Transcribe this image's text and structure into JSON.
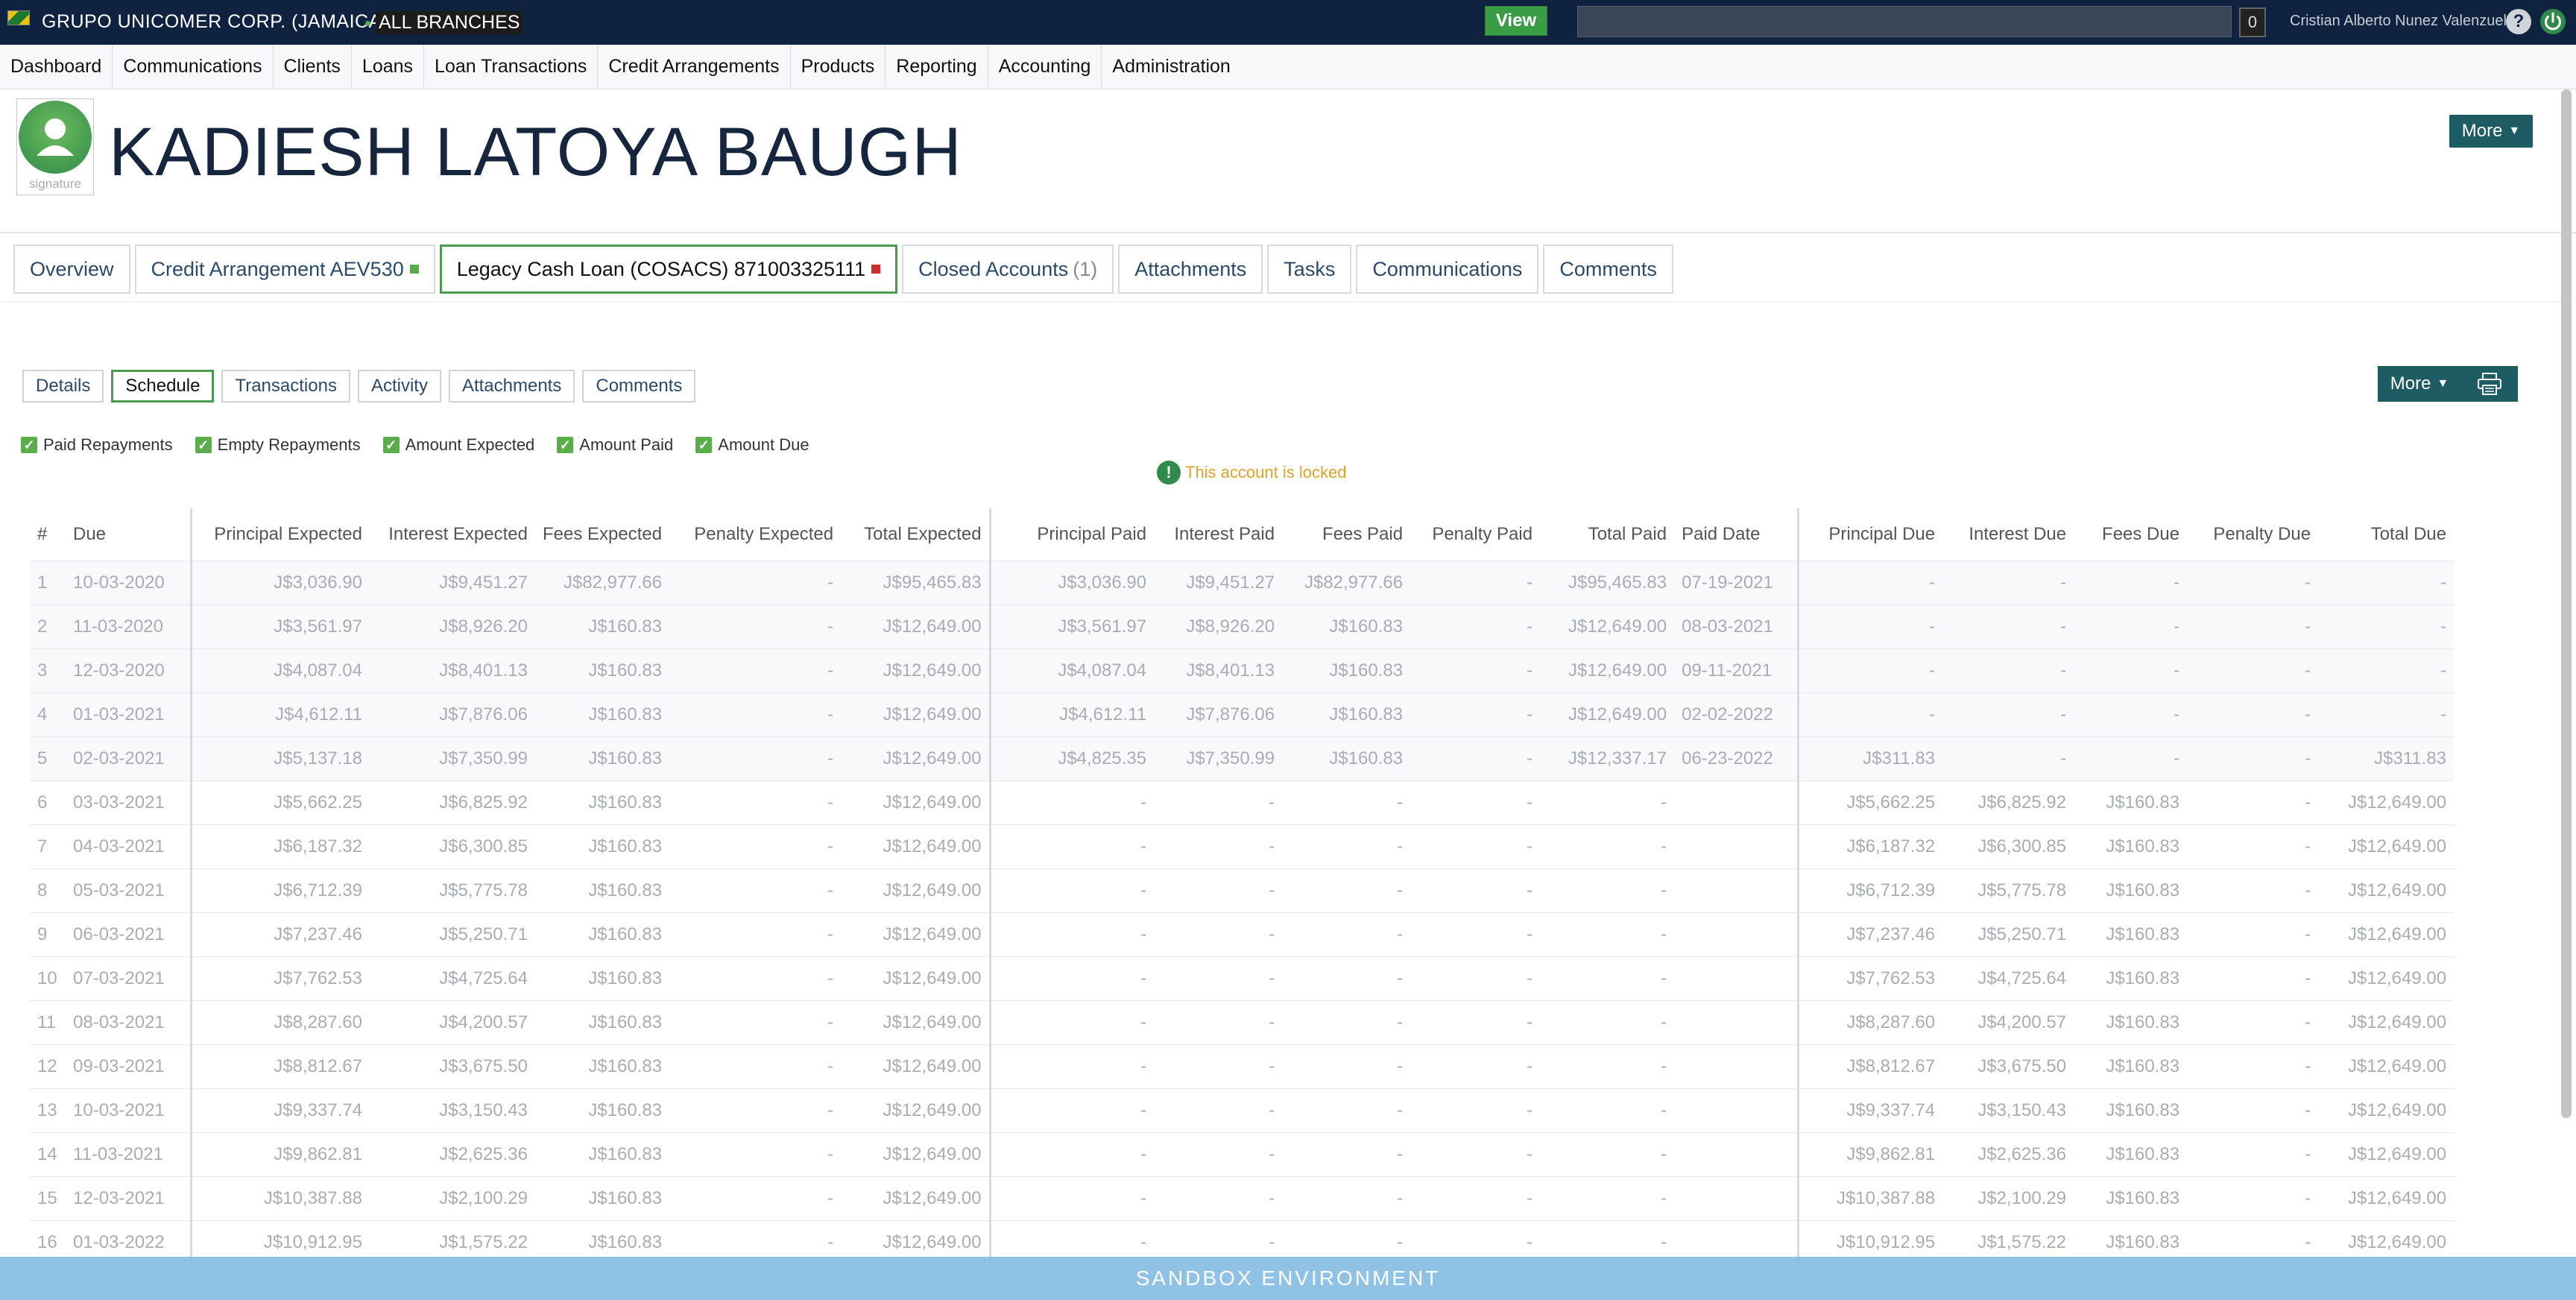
{
  "topbar": {
    "org_name": "GRUPO UNICOMER CORP. (JAMAICA)",
    "branch": "ALL BRANCHES",
    "view_label": "View",
    "search_value": "",
    "notif_count": "0",
    "user_name": "Cristian Alberto Nunez Valenzuela",
    "help_label": "?"
  },
  "nav": {
    "items": [
      "Dashboard",
      "Communications",
      "Clients",
      "Loans",
      "Loan Transactions",
      "Credit Arrangements",
      "Products",
      "Reporting",
      "Accounting",
      "Administration"
    ]
  },
  "client": {
    "name": "KADIESH LATOYA BAUGH",
    "avatar_label": "signature",
    "more_label": "More"
  },
  "account_tabs": {
    "overview": "Overview",
    "credit_arrangement": "Credit Arrangement AEV530",
    "legacy_loan": "Legacy Cash Loan (COSACS) 871003325111",
    "closed_accounts": "Closed Accounts",
    "closed_count": "(1)",
    "attachments": "Attachments",
    "tasks": "Tasks",
    "communications": "Communications",
    "comments": "Comments"
  },
  "sub_tabs": {
    "details": "Details",
    "schedule": "Schedule",
    "transactions": "Transactions",
    "activity": "Activity",
    "attachments": "Attachments",
    "comments": "Comments",
    "more_label": "More"
  },
  "filters": {
    "paid_repayments": "Paid Repayments",
    "empty_repayments": "Empty Repayments",
    "amount_expected": "Amount Expected",
    "amount_paid": "Amount Paid",
    "amount_due": "Amount Due"
  },
  "lock_message": "This account is locked",
  "columns": [
    "#",
    "Due",
    "Principal Expected",
    "Interest Expected",
    "Fees Expected",
    "Penalty Expected",
    "Total Expected",
    "Principal Paid",
    "Interest Paid",
    "Fees Paid",
    "Penalty Paid",
    "Total Paid",
    "Paid Date",
    "Principal Due",
    "Interest Due",
    "Fees Due",
    "Penalty Due",
    "Total Due"
  ],
  "rows": [
    [
      "1",
      "10-03-2020",
      "J$3,036.90",
      "J$9,451.27",
      "J$82,977.66",
      "-",
      "J$95,465.83",
      "J$3,036.90",
      "J$9,451.27",
      "J$82,977.66",
      "-",
      "J$95,465.83",
      "07-19-2021",
      "-",
      "-",
      "-",
      "-",
      "-"
    ],
    [
      "2",
      "11-03-2020",
      "J$3,561.97",
      "J$8,926.20",
      "J$160.83",
      "-",
      "J$12,649.00",
      "J$3,561.97",
      "J$8,926.20",
      "J$160.83",
      "-",
      "J$12,649.00",
      "08-03-2021",
      "-",
      "-",
      "-",
      "-",
      "-"
    ],
    [
      "3",
      "12-03-2020",
      "J$4,087.04",
      "J$8,401.13",
      "J$160.83",
      "-",
      "J$12,649.00",
      "J$4,087.04",
      "J$8,401.13",
      "J$160.83",
      "-",
      "J$12,649.00",
      "09-11-2021",
      "-",
      "-",
      "-",
      "-",
      "-"
    ],
    [
      "4",
      "01-03-2021",
      "J$4,612.11",
      "J$7,876.06",
      "J$160.83",
      "-",
      "J$12,649.00",
      "J$4,612.11",
      "J$7,876.06",
      "J$160.83",
      "-",
      "J$12,649.00",
      "02-02-2022",
      "-",
      "-",
      "-",
      "-",
      "-"
    ],
    [
      "5",
      "02-03-2021",
      "J$5,137.18",
      "J$7,350.99",
      "J$160.83",
      "-",
      "J$12,649.00",
      "J$4,825.35",
      "J$7,350.99",
      "J$160.83",
      "-",
      "J$12,337.17",
      "06-23-2022",
      "J$311.83",
      "-",
      "-",
      "-",
      "J$311.83"
    ],
    [
      "6",
      "03-03-2021",
      "J$5,662.25",
      "J$6,825.92",
      "J$160.83",
      "-",
      "J$12,649.00",
      "-",
      "-",
      "-",
      "-",
      "-",
      "",
      "J$5,662.25",
      "J$6,825.92",
      "J$160.83",
      "-",
      "J$12,649.00"
    ],
    [
      "7",
      "04-03-2021",
      "J$6,187.32",
      "J$6,300.85",
      "J$160.83",
      "-",
      "J$12,649.00",
      "-",
      "-",
      "-",
      "-",
      "-",
      "",
      "J$6,187.32",
      "J$6,300.85",
      "J$160.83",
      "-",
      "J$12,649.00"
    ],
    [
      "8",
      "05-03-2021",
      "J$6,712.39",
      "J$5,775.78",
      "J$160.83",
      "-",
      "J$12,649.00",
      "-",
      "-",
      "-",
      "-",
      "-",
      "",
      "J$6,712.39",
      "J$5,775.78",
      "J$160.83",
      "-",
      "J$12,649.00"
    ],
    [
      "9",
      "06-03-2021",
      "J$7,237.46",
      "J$5,250.71",
      "J$160.83",
      "-",
      "J$12,649.00",
      "-",
      "-",
      "-",
      "-",
      "-",
      "",
      "J$7,237.46",
      "J$5,250.71",
      "J$160.83",
      "-",
      "J$12,649.00"
    ],
    [
      "10",
      "07-03-2021",
      "J$7,762.53",
      "J$4,725.64",
      "J$160.83",
      "-",
      "J$12,649.00",
      "-",
      "-",
      "-",
      "-",
      "-",
      "",
      "J$7,762.53",
      "J$4,725.64",
      "J$160.83",
      "-",
      "J$12,649.00"
    ],
    [
      "11",
      "08-03-2021",
      "J$8,287.60",
      "J$4,200.57",
      "J$160.83",
      "-",
      "J$12,649.00",
      "-",
      "-",
      "-",
      "-",
      "-",
      "",
      "J$8,287.60",
      "J$4,200.57",
      "J$160.83",
      "-",
      "J$12,649.00"
    ],
    [
      "12",
      "09-03-2021",
      "J$8,812.67",
      "J$3,675.50",
      "J$160.83",
      "-",
      "J$12,649.00",
      "-",
      "-",
      "-",
      "-",
      "-",
      "",
      "J$8,812.67",
      "J$3,675.50",
      "J$160.83",
      "-",
      "J$12,649.00"
    ],
    [
      "13",
      "10-03-2021",
      "J$9,337.74",
      "J$3,150.43",
      "J$160.83",
      "-",
      "J$12,649.00",
      "-",
      "-",
      "-",
      "-",
      "-",
      "",
      "J$9,337.74",
      "J$3,150.43",
      "J$160.83",
      "-",
      "J$12,649.00"
    ],
    [
      "14",
      "11-03-2021",
      "J$9,862.81",
      "J$2,625.36",
      "J$160.83",
      "-",
      "J$12,649.00",
      "-",
      "-",
      "-",
      "-",
      "-",
      "",
      "J$9,862.81",
      "J$2,625.36",
      "J$160.83",
      "-",
      "J$12,649.00"
    ],
    [
      "15",
      "12-03-2021",
      "J$10,387.88",
      "J$2,100.29",
      "J$160.83",
      "-",
      "J$12,649.00",
      "-",
      "-",
      "-",
      "-",
      "-",
      "",
      "J$10,387.88",
      "J$2,100.29",
      "J$160.83",
      "-",
      "J$12,649.00"
    ],
    [
      "16",
      "01-03-2022",
      "J$10,912.95",
      "J$1,575.22",
      "J$160.83",
      "-",
      "J$12,649.00",
      "-",
      "-",
      "-",
      "-",
      "-",
      "",
      "J$10,912.95",
      "J$1,575.22",
      "J$160.83",
      "-",
      "J$12,649.00"
    ]
  ],
  "sandbox_label": "SANDBOX ENVIRONMENT",
  "colors": {
    "topbar_bg": "#0f2340",
    "accent_teal": "#1d5c63",
    "active_green": "#4c9a4f",
    "view_green": "#3a9d45",
    "lock_text": "#e0a22a"
  }
}
